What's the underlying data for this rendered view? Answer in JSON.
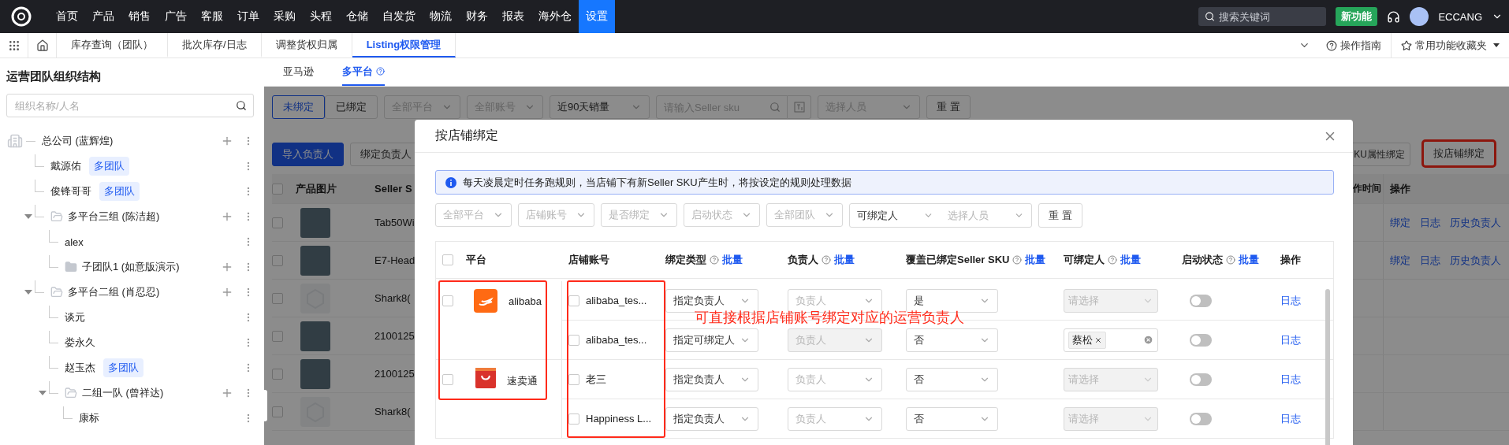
{
  "nav": {
    "items": [
      {
        "label": "首页",
        "selected": false
      },
      {
        "label": "产品",
        "selected": false
      },
      {
        "label": "销售",
        "selected": false
      },
      {
        "label": "广告",
        "selected": false
      },
      {
        "label": "客服",
        "selected": false
      },
      {
        "label": "订单",
        "selected": false
      },
      {
        "label": "采购",
        "selected": false
      },
      {
        "label": "头程",
        "selected": false
      },
      {
        "label": "仓储",
        "selected": false
      },
      {
        "label": "自发货",
        "selected": false
      },
      {
        "label": "物流",
        "selected": false
      },
      {
        "label": "财务",
        "selected": false
      },
      {
        "label": "报表",
        "selected": false
      },
      {
        "label": "海外仓",
        "selected": false
      },
      {
        "label": "设置",
        "selected": true
      }
    ],
    "search": {
      "placeholder": "搜索关键词"
    },
    "new_feature": "新功能",
    "user": "ECCANG"
  },
  "tabs": {
    "items": [
      {
        "label": "库存查询（团队）",
        "selected": false
      },
      {
        "label": "批次库存/日志",
        "selected": false
      },
      {
        "label": "调整货权归属",
        "selected": false
      },
      {
        "label": "Listing权限管理",
        "selected": true
      }
    ],
    "guide": "操作指南",
    "favorites": "常用功能收藏夹"
  },
  "sidebar": {
    "title": "运营团队组织结构",
    "search": {
      "placeholder": "组织名称/人名"
    },
    "tree": [
      {
        "label": "总公司 (蓝辉煌)",
        "kind": "root",
        "children": [
          {
            "label": "戴源佑",
            "kind": "person",
            "badge": "多团队"
          },
          {
            "label": "俊锋哥哥",
            "kind": "person",
            "badge": "多团队"
          },
          {
            "label": "多平台三组 (陈洁超)",
            "kind": "group",
            "expanded": true,
            "children": [
              {
                "label": "alex",
                "kind": "person"
              },
              {
                "label": "子团队1 (如意版演示)",
                "kind": "group",
                "expanded": false
              }
            ]
          },
          {
            "label": "多平台二组 (肖忍忍)",
            "kind": "group",
            "expanded": true,
            "children": [
              {
                "label": "谈元",
                "kind": "person"
              },
              {
                "label": "娄永久",
                "kind": "person"
              },
              {
                "label": "赵玉杰",
                "kind": "person",
                "badge": "多团队"
              },
              {
                "label": "二组一队 (曾祥达)",
                "kind": "group",
                "expanded": true,
                "children": [
                  {
                    "label": "康标",
                    "kind": "person"
                  }
                ]
              }
            ]
          }
        ]
      }
    ]
  },
  "subtabs": [
    {
      "label": "亚马逊",
      "selected": false,
      "help": false
    },
    {
      "label": "多平台",
      "selected": true,
      "help": true
    }
  ],
  "filters": {
    "bind_state": [
      {
        "label": "未绑定",
        "selected": true
      },
      {
        "label": "已绑定",
        "selected": false
      }
    ],
    "selects": [
      {
        "placeholder": "全部平台"
      },
      {
        "placeholder": "全部账号"
      },
      {
        "value": "近90天销量"
      }
    ],
    "sku_search": {
      "placeholder": "请输入Seller sku"
    },
    "person": {
      "placeholder": "选择人员"
    },
    "reset": "重 置"
  },
  "actions": {
    "left": [
      {
        "label": "导入负责人",
        "kind": "primary"
      },
      {
        "label": "绑定负责人",
        "kind": "default"
      }
    ],
    "right": [
      {
        "label": "KU属性绑定",
        "highlighted": false
      },
      {
        "label": "按店铺绑定",
        "highlighted": true
      }
    ]
  },
  "table": {
    "header_checked": false,
    "columns": [
      "产品图片",
      "Seller S",
      "作时间",
      "操作"
    ],
    "rows": [
      {
        "checked": false,
        "kind": "photo",
        "sku": "Tab50Wi",
        "actions": [
          "绑定",
          "日志",
          "历史负责人"
        ]
      },
      {
        "checked": false,
        "kind": "photo",
        "sku": "E7-Head",
        "actions": [
          "绑定",
          "日志",
          "历史负责人"
        ]
      },
      {
        "checked": false,
        "kind": "placeholder",
        "sku": "Shark8(",
        "actions": []
      },
      {
        "checked": false,
        "kind": "photo",
        "sku": "2100125",
        "actions": []
      },
      {
        "checked": false,
        "kind": "photo",
        "sku": "2100125",
        "actions": []
      },
      {
        "checked": false,
        "kind": "placeholder",
        "sku": "Shark8(",
        "actions": []
      }
    ]
  },
  "modal": {
    "title": "按店铺绑定",
    "notice": "每天凌晨定时任务跑规则，当店铺下有新Seller SKU产生时，将按设定的规则处理数据",
    "filters": [
      {
        "placeholder": "全部平台"
      },
      {
        "placeholder": "店铺账号"
      },
      {
        "placeholder": "是否绑定"
      },
      {
        "placeholder": "启动状态"
      },
      {
        "placeholder": "全部团队"
      }
    ],
    "assignable_filter": {
      "value": "可绑定人",
      "placeholder": "选择人员"
    },
    "reset": "重 置",
    "header_checked": false,
    "columns": [
      {
        "label": "平台",
        "help": false
      },
      {
        "label": "店铺账号",
        "help": false
      },
      {
        "label": "绑定类型",
        "help": true,
        "batch": "批量"
      },
      {
        "label": "负责人",
        "help": true,
        "batch": "批量"
      },
      {
        "label": "覆盖已绑定Seller SKU",
        "help": true,
        "batch": "批量"
      },
      {
        "label": "可绑定人",
        "help": true,
        "batch": "批量"
      },
      {
        "label": "启动状态",
        "help": true,
        "batch": "批量"
      },
      {
        "label": "操作",
        "help": false
      }
    ],
    "platforms_highlighted": true,
    "accounts_highlighted": true,
    "annotation": "可直接根据店铺账号绑定对应的运营负责人",
    "platforms": [
      {
        "name": "alibaba",
        "kind": "alibaba",
        "checked": false,
        "accounts": [
          {
            "name": "alibaba_tes...",
            "checked": false,
            "bind_type": "指定负责人",
            "owner": {
              "placeholder": "负责人",
              "disabled": false
            },
            "override": "是",
            "assignable": {
              "placeholder": "请选择",
              "disabled": true
            },
            "enabled": false,
            "action": "日志"
          },
          {
            "name": "alibaba_tes...",
            "checked": false,
            "bind_type": "指定可绑定人",
            "owner": {
              "placeholder": "负责人",
              "disabled": true
            },
            "override": "否",
            "assignable": {
              "tags": [
                "蔡松"
              ],
              "disabled": false
            },
            "enabled": false,
            "action": "日志"
          }
        ]
      },
      {
        "name": "速卖通",
        "kind": "aliexpress",
        "checked": false,
        "accounts": [
          {
            "name": "老三",
            "checked": false,
            "bind_type": "指定负责人",
            "owner": {
              "placeholder": "负责人",
              "disabled": false
            },
            "override": "否",
            "assignable": {
              "placeholder": "请选择",
              "disabled": true
            },
            "enabled": false,
            "action": "日志"
          },
          {
            "name": "Happiness L...",
            "checked": false,
            "bind_type": "指定负责人",
            "owner": {
              "placeholder": "负责人",
              "disabled": false
            },
            "override": "否",
            "assignable": {
              "placeholder": "请选择",
              "disabled": true
            },
            "enabled": false,
            "action": "日志"
          }
        ]
      }
    ]
  }
}
